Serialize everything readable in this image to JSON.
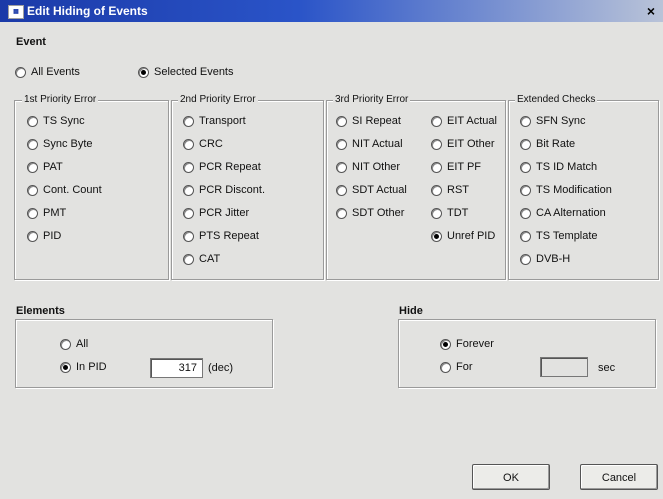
{
  "window": {
    "title": "Edit Hiding of Events",
    "icon": "app-icon",
    "close": "×"
  },
  "event": {
    "label": "Event",
    "all_events": "All Events",
    "selected_events": "Selected Events",
    "selected": "selected_events"
  },
  "groups": {
    "p1": {
      "title": "1st Priority Error",
      "items": [
        "TS Sync",
        "Sync Byte",
        "PAT",
        "Cont. Count",
        "PMT",
        "PID"
      ]
    },
    "p2": {
      "title": "2nd Priority Error",
      "items": [
        "Transport",
        "CRC",
        "PCR Repeat",
        "PCR Discont.",
        "PCR Jitter",
        "PTS Repeat",
        "CAT"
      ]
    },
    "p3": {
      "title": "3rd Priority Error",
      "col1": [
        "SI Repeat",
        "NIT Actual",
        "NIT Other",
        "SDT Actual",
        "SDT Other"
      ],
      "col2": [
        "EIT Actual",
        "EIT Other",
        "EIT PF",
        "RST",
        "TDT",
        "Unref PID"
      ],
      "checked": "Unref PID"
    },
    "ext": {
      "title": "Extended Checks",
      "items": [
        "SFN Sync",
        "Bit Rate",
        "TS ID Match",
        "TS Modification",
        "CA Alternation",
        "TS Template",
        "DVB-H"
      ]
    }
  },
  "elements": {
    "label": "Elements",
    "all": "All",
    "in_pid": "In PID",
    "pid_value": "317",
    "unit": "(dec)",
    "selected": "in_pid"
  },
  "hide": {
    "label": "Hide",
    "forever": "Forever",
    "for": "For",
    "sec_value": "",
    "unit": "sec",
    "selected": "forever"
  },
  "buttons": {
    "ok": "OK",
    "cancel": "Cancel"
  }
}
